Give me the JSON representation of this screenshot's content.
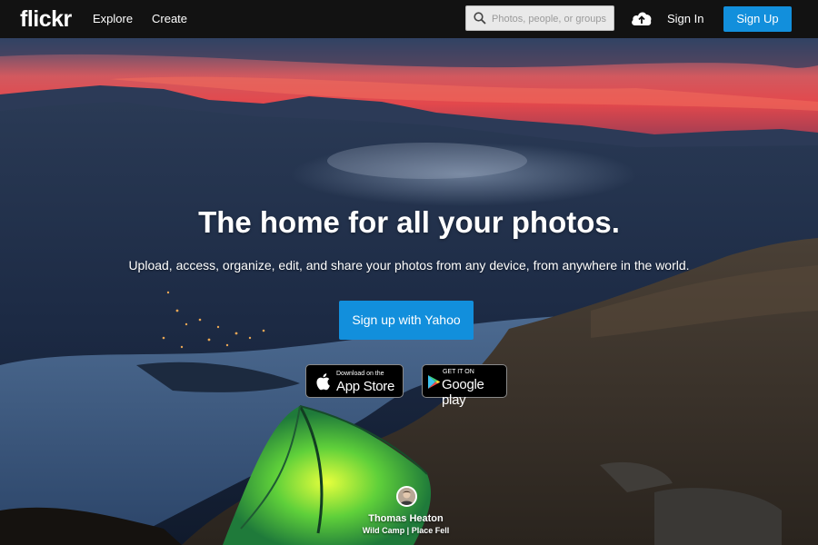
{
  "nav": {
    "logo": "flickr",
    "explore_label": "Explore",
    "create_label": "Create",
    "search_placeholder": "Photos, people, or groups",
    "upload_icon": "cloud-upload-icon",
    "signin_label": "Sign In",
    "signup_label": "Sign Up"
  },
  "hero": {
    "headline": "The home for all your photos.",
    "subline": "Upload, access, organize, edit, and share your photos from any device, from anywhere in the world.",
    "cta_label": "Sign up with Yahoo",
    "appstore": {
      "small": "Download on the",
      "big": "App Store",
      "icon": "apple-icon"
    },
    "googleplay": {
      "small": "GET IT ON",
      "big": "Google play",
      "icon": "google-play-icon"
    }
  },
  "credit": {
    "name": "Thomas Heaton",
    "title": "Wild Camp | Place Fell"
  },
  "colors": {
    "topbar": "#121212",
    "accent_blue": "#128fdc",
    "sunset": "#e0454a"
  }
}
